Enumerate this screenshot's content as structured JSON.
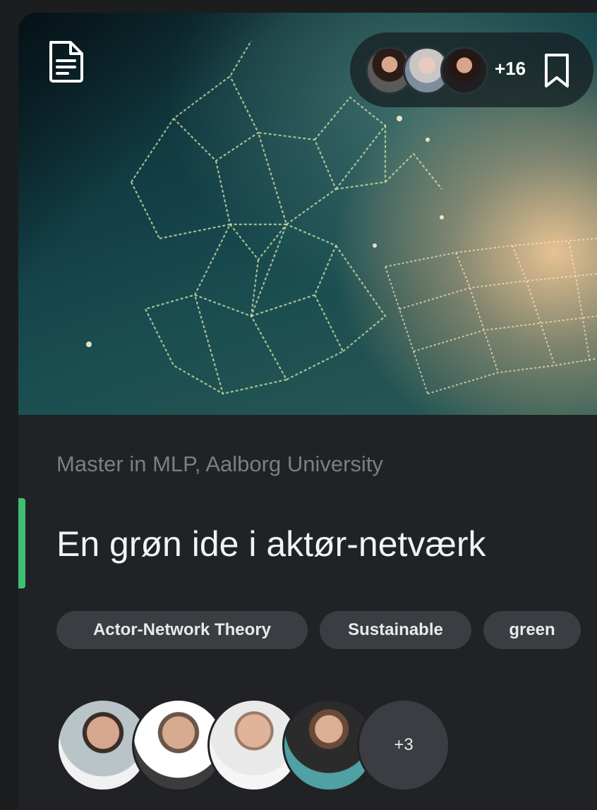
{
  "header": {
    "type_icon": "document-icon",
    "collaborators_more": "+16",
    "bookmark_icon": "bookmark-icon"
  },
  "project": {
    "affiliation": "Master in MLP, Aalborg University",
    "title": "En grøn ide i aktør-netværk",
    "tags": [
      "Actor-Network Theory",
      "Sustainable",
      "green"
    ]
  },
  "authors": {
    "more": "+3"
  },
  "colors": {
    "accent": "#3fbf72",
    "card_bg": "#202225",
    "tag_bg": "#3b3d42"
  }
}
